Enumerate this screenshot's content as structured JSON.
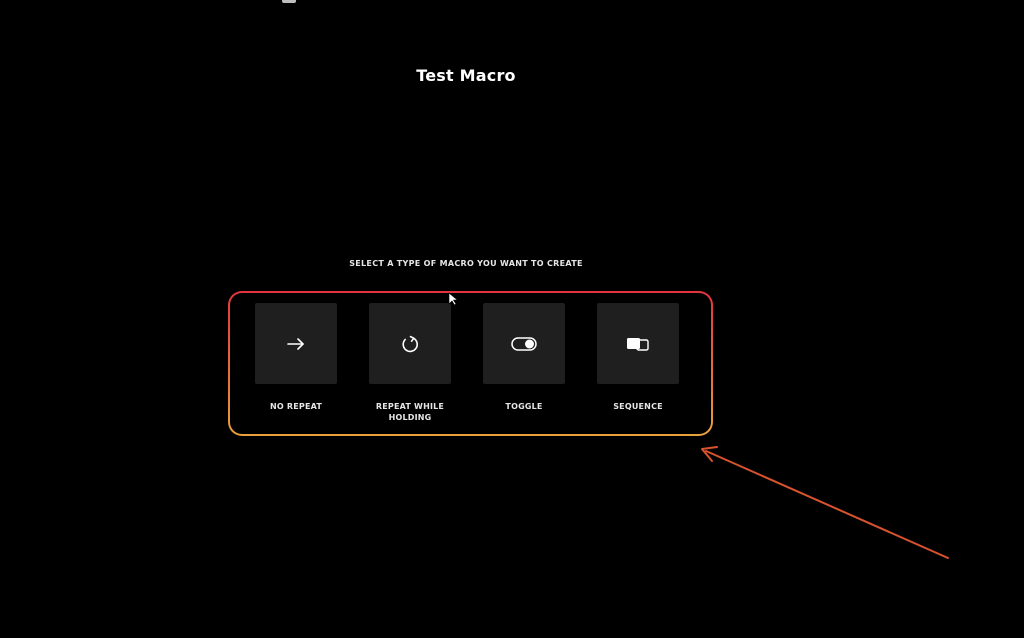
{
  "macro": {
    "title": "Test Macro"
  },
  "prompt": {
    "text": "SELECT A TYPE OF MACRO YOU WANT TO CREATE"
  },
  "options": [
    {
      "label": "NO REPEAT",
      "icon": "arrow-right-icon"
    },
    {
      "label": "REPEAT WHILE HOLDING",
      "icon": "repeat-circle-icon"
    },
    {
      "label": "TOGGLE",
      "icon": "toggle-switch-icon"
    },
    {
      "label": "SEQUENCE",
      "icon": "sequence-icon"
    }
  ],
  "annotation": {
    "highlight_color": "#e3343f",
    "arrow_color": "#d9532f"
  },
  "colors": {
    "background": "#000000",
    "tile": "#1f1f1f",
    "text": "#ffffff"
  }
}
